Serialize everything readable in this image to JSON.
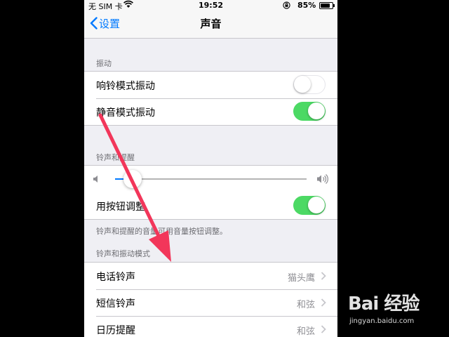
{
  "status_bar": {
    "carrier": "无 SIM 卡",
    "time": "19:52",
    "battery_pct": "85%",
    "battery_level": 0.85
  },
  "nav": {
    "back_label": "设置",
    "title": "声音"
  },
  "vibrate_section": {
    "header": "振动",
    "rows": [
      {
        "label": "响铃模式振动",
        "on": false
      },
      {
        "label": "静音模式振动",
        "on": true
      }
    ]
  },
  "ringer_section": {
    "header": "铃声和提醒",
    "volume_level": 0.09,
    "change_with_buttons": {
      "label": "用按钮调整",
      "on": true
    },
    "footer": "铃声和提醒的音量可用音量按钮调整。"
  },
  "patterns_section": {
    "header": "铃声和振动模式",
    "rows": [
      {
        "label": "电话铃声",
        "value": "猫头鹰"
      },
      {
        "label": "短信铃声",
        "value": "和弦"
      },
      {
        "label": "日历提醒",
        "value": "和弦"
      }
    ]
  },
  "watermark": {
    "logo": "Bai 经验",
    "url": "jingyan.baidu.com"
  },
  "colors": {
    "accent": "#007aff",
    "toggle_on": "#4cd964",
    "annotation_arrow": "#f2365a"
  }
}
